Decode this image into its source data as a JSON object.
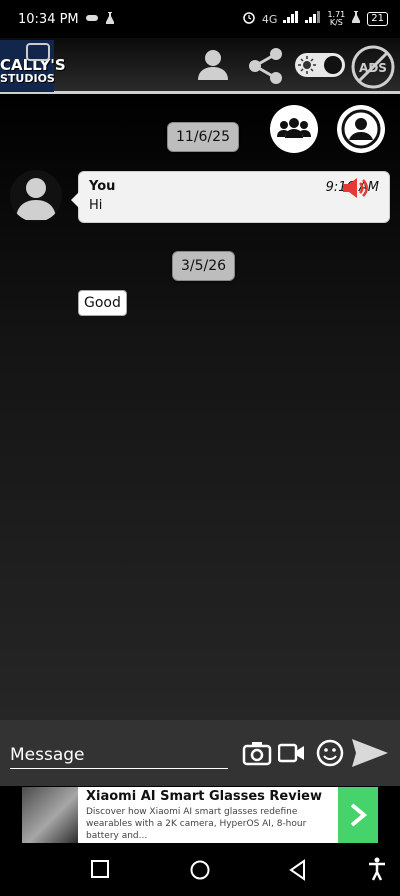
{
  "status_bar": {
    "time": "10:34 PM",
    "network": "4G",
    "speed": "1.71",
    "speed_unit": "K/S",
    "battery": "21"
  },
  "app": {
    "logo_line1": "CALLY'S",
    "logo_line2": "STUDIOS",
    "ads_label": "ADS"
  },
  "chat": {
    "dates": [
      "11/6/25",
      "3/5/26"
    ],
    "messages": [
      {
        "sender": "You",
        "text": "Hi",
        "time": "9:16 AM"
      }
    ],
    "replies": [
      "Good"
    ]
  },
  "input": {
    "placeholder": "Message"
  },
  "ad": {
    "title": "Xiaomi AI Smart Glasses Review",
    "body": "Discover how Xiaomi AI smart glasses redefine wearables with a 2K camera, HyperOS AI, 8-hour battery and..."
  },
  "colors": {
    "accent_red": "#e53935",
    "ad_green": "#46d36c",
    "chip_gray": "#bdbdbd"
  },
  "icons": {
    "profile": "person-icon",
    "share": "share-icon",
    "theme_toggle": "theme-toggle-icon",
    "no_ads": "no-ads-icon",
    "group": "group-icon",
    "account": "account-icon",
    "camera": "camera-icon",
    "video": "video-icon",
    "emoji": "emoji-icon",
    "send": "send-icon"
  }
}
